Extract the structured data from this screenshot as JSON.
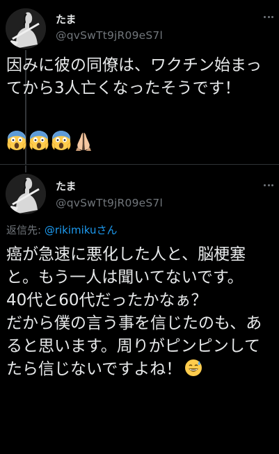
{
  "tweets": [
    {
      "display_name": "たま",
      "handle": "@qvSwTt9jR09eS7l",
      "text": "因みに彼の同僚は、ワクチン始まってから3人亡くなったそうです！",
      "emojis": [
        "face-screaming-in-fear",
        "face-screaming-in-fear",
        "face-screaming-in-fear",
        "folded-hands"
      ]
    },
    {
      "display_name": "たま",
      "handle": "@qvSwTt9jR09eS7l",
      "reply_label": "返信先: ",
      "reply_to": "@rikimiku",
      "reply_suffix": "さん",
      "text": "癌が急速に悪化した人と、脳梗塞と。もう一人は聞いてないです。\n40代と60代だったかなぁ？\nだから僕の言う事を信じたのも、あると思います。周りがピンピンしてたら信じないですよね！",
      "trailing_emoji": "grinning-face-with-sweat"
    }
  ],
  "colors": {
    "background": "#000000",
    "text": "#e7e9ea",
    "secondary": "#71767b",
    "link": "#1d9bf0"
  }
}
